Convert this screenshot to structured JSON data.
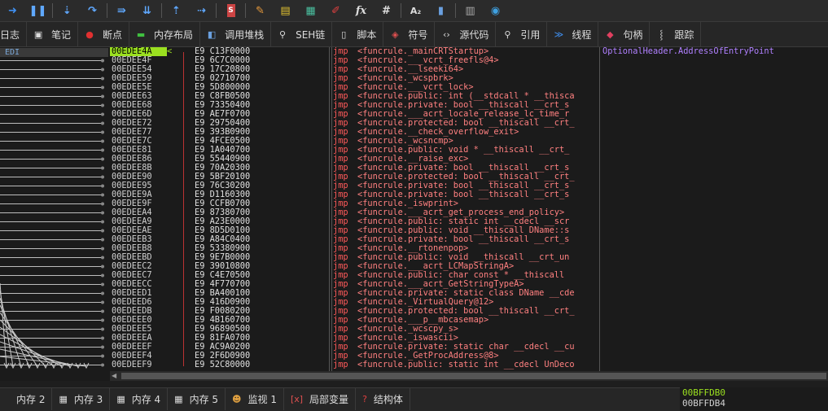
{
  "toolbar": {
    "icons": [
      "arrow-right-icon",
      "pause-icon",
      "step-into-icon",
      "step-over-icon",
      "run-to-icon",
      "step-down-icon",
      "step-up-icon",
      "execute-till-icon",
      "script-icon",
      "pen-icon",
      "highlight-icon",
      "pattern-icon",
      "erase-icon",
      "fx",
      "#",
      "A2",
      "find-icon",
      "calc-icon",
      "globe-icon"
    ],
    "text": {
      "fx": "fx",
      "hash": "#",
      "a2": "A₂"
    }
  },
  "tabs": [
    {
      "label": "日志",
      "icon": "log-icon"
    },
    {
      "label": "笔记",
      "icon": "notes-icon"
    },
    {
      "label": "断点",
      "icon": "breakpoint-icon"
    },
    {
      "label": "内存布局",
      "icon": "memory-map-icon"
    },
    {
      "label": "调用堆栈",
      "icon": "call-stack-icon"
    },
    {
      "label": "SEH链",
      "icon": "seh-icon"
    },
    {
      "label": "脚本",
      "icon": "script-icon"
    },
    {
      "label": "符号",
      "icon": "symbols-icon"
    },
    {
      "label": "源代码",
      "icon": "source-icon"
    },
    {
      "label": "引用",
      "icon": "references-icon"
    },
    {
      "label": "线程",
      "icon": "threads-icon"
    },
    {
      "label": "句柄",
      "icon": "handles-icon"
    },
    {
      "label": "跟踪",
      "icon": "trace-icon"
    }
  ],
  "graph": {
    "register_label": "EDI"
  },
  "disasm": {
    "rows": [
      {
        "addr": "00EDEE4A",
        "arrow": "<",
        "bytes": "E9 C13F0000",
        "mn": "jmp",
        "op": "<funcrule._mainCRTStartup>",
        "sel": true
      },
      {
        "addr": "00EDEE4F",
        "arrow": "",
        "bytes": "E9 6C7C0000",
        "mn": "jmp",
        "op": "<funcrule.___vcrt_freefls@4>"
      },
      {
        "addr": "00EDEE54",
        "arrow": "",
        "bytes": "E9 17C20800",
        "mn": "jmp",
        "op": "<funcrule.__lseeki64>"
      },
      {
        "addr": "00EDEE59",
        "arrow": "",
        "bytes": "E9 02710700",
        "mn": "jmp",
        "op": "<funcrule._wcspbrk>"
      },
      {
        "addr": "00EDEE5E",
        "arrow": "",
        "bytes": "E9 5D800000",
        "mn": "jmp",
        "op": "<funcrule.___vcrt_lock>"
      },
      {
        "addr": "00EDEE63",
        "arrow": "",
        "bytes": "E9 C8FB0500",
        "mn": "jmp",
        "op": "<funcrule.public: int (__stdcall * __thisca"
      },
      {
        "addr": "00EDEE68",
        "arrow": "",
        "bytes": "E9 73350400",
        "mn": "jmp",
        "op": "<funcrule.private: bool __thiscall __crt_s"
      },
      {
        "addr": "00EDEE6D",
        "arrow": "",
        "bytes": "E9 AE7F0700",
        "mn": "jmp",
        "op": "<funcrule.___acrt_locale_release_lc_time_r"
      },
      {
        "addr": "00EDEE72",
        "arrow": "",
        "bytes": "E9 29750400",
        "mn": "jmp",
        "op": "<funcrule.protected: bool __thiscall __crt_"
      },
      {
        "addr": "00EDEE77",
        "arrow": "",
        "bytes": "E9 393B0900",
        "mn": "jmp",
        "op": "<funcrule.__check_overflow_exit>"
      },
      {
        "addr": "00EDEE7C",
        "arrow": "",
        "bytes": "E9 4FCE0500",
        "mn": "jmp",
        "op": "<funcrule._wcsncmp>"
      },
      {
        "addr": "00EDEE81",
        "arrow": "",
        "bytes": "E9 1A040700",
        "mn": "jmp",
        "op": "<funcrule.public: void * __thiscall __crt_"
      },
      {
        "addr": "00EDEE86",
        "arrow": "",
        "bytes": "E9 55440900",
        "mn": "jmp",
        "op": "<funcrule.__raise_exc>"
      },
      {
        "addr": "00EDEE8B",
        "arrow": "",
        "bytes": "E9 70A20300",
        "mn": "jmp",
        "op": "<funcrule.private: bool __thiscall __crt_s"
      },
      {
        "addr": "00EDEE90",
        "arrow": "",
        "bytes": "E9 5BF20100",
        "mn": "jmp",
        "op": "<funcrule.protected: bool __thiscall __crt_"
      },
      {
        "addr": "00EDEE95",
        "arrow": "",
        "bytes": "E9 76C30200",
        "mn": "jmp",
        "op": "<funcrule.private: bool __thiscall __crt_s"
      },
      {
        "addr": "00EDEE9A",
        "arrow": "",
        "bytes": "E9 D1160300",
        "mn": "jmp",
        "op": "<funcrule.private: bool __thiscall __crt_s"
      },
      {
        "addr": "00EDEE9F",
        "arrow": "",
        "bytes": "E9 CCFB0700",
        "mn": "jmp",
        "op": "<funcrule._iswprint>"
      },
      {
        "addr": "00EDEEA4",
        "arrow": "",
        "bytes": "E9 87380700",
        "mn": "jmp",
        "op": "<funcrule.___acrt_get_process_end_policy>"
      },
      {
        "addr": "00EDEEA9",
        "arrow": "",
        "bytes": "E9 A23E0000",
        "mn": "jmp",
        "op": "<funcrule.public: static int __cdecl __scr"
      },
      {
        "addr": "00EDEEAE",
        "arrow": "",
        "bytes": "E9 8D5D0100",
        "mn": "jmp",
        "op": "<funcrule.public: void __thiscall DName::s"
      },
      {
        "addr": "00EDEEB3",
        "arrow": "",
        "bytes": "E9 A84C0400",
        "mn": "jmp",
        "op": "<funcrule.private: bool __thiscall __crt_s"
      },
      {
        "addr": "00EDEEB8",
        "arrow": "",
        "bytes": "E9 53380900",
        "mn": "jmp",
        "op": "<funcrule.__rtonenpop>"
      },
      {
        "addr": "00EDEEBD",
        "arrow": "",
        "bytes": "E9 9E7B0000",
        "mn": "jmp",
        "op": "<funcrule.public: void __thiscall __crt_un"
      },
      {
        "addr": "00EDEEC2",
        "arrow": "",
        "bytes": "E9 39010800",
        "mn": "jmp",
        "op": "<funcrule.___acrt_LCMapStringA>"
      },
      {
        "addr": "00EDEEC7",
        "arrow": "",
        "bytes": "E9 C4E70500",
        "mn": "jmp",
        "op": "<funcrule.public: char const * __thiscall "
      },
      {
        "addr": "00EDEECC",
        "arrow": "",
        "bytes": "E9 4F770700",
        "mn": "jmp",
        "op": "<funcrule.___acrt_GetStringTypeA>"
      },
      {
        "addr": "00EDEED1",
        "arrow": "",
        "bytes": "E9 BA400100",
        "mn": "jmp",
        "op": "<funcrule.private: static class DName __cde"
      },
      {
        "addr": "00EDEED6",
        "arrow": "",
        "bytes": "E9 416D0900",
        "mn": "jmp",
        "op": "<funcrule._VirtualQuery@12>"
      },
      {
        "addr": "00EDEEDB",
        "arrow": "",
        "bytes": "E9 F0080200",
        "mn": "jmp",
        "op": "<funcrule.protected: bool __thiscall __crt_"
      },
      {
        "addr": "00EDEEE0",
        "arrow": "",
        "bytes": "E9 4B160700",
        "mn": "jmp",
        "op": "<funcrule.___p__mbcasemap>"
      },
      {
        "addr": "00EDEEE5",
        "arrow": "",
        "bytes": "E9 96890500",
        "mn": "jmp",
        "op": "<funcrule._wcscpy_s>"
      },
      {
        "addr": "00EDEEEA",
        "arrow": "",
        "bytes": "E9 81FA0700",
        "mn": "jmp",
        "op": "<funcrule._iswascii>"
      },
      {
        "addr": "00EDEEEF",
        "arrow": "",
        "bytes": "E9 AC9A0200",
        "mn": "jmp",
        "op": "<funcrule.private: static char __cdecl __cu"
      },
      {
        "addr": "00EDEEF4",
        "arrow": "",
        "bytes": "E9 2F6D0900",
        "mn": "jmp",
        "op": "<funcrule._GetProcAddress@8>"
      },
      {
        "addr": "00EDEEF9",
        "arrow": "",
        "bytes": "E9 52C80000",
        "mn": "jmp",
        "op": "<funcrule.public: static int __cdecl UnDeco"
      }
    ],
    "comment": "OptionalHeader.AddressOfEntryPoint"
  },
  "bottom_tabs": [
    {
      "label": "内存 2",
      "icon": "memory-icon"
    },
    {
      "label": "内存 3",
      "icon": "memory-icon"
    },
    {
      "label": "内存 4",
      "icon": "memory-icon"
    },
    {
      "label": "内存 5",
      "icon": "memory-icon"
    },
    {
      "label": "监视 1",
      "icon": "watch-icon"
    },
    {
      "label": "局部变量",
      "icon": "locals-icon"
    },
    {
      "label": "结构体",
      "icon": "struct-icon"
    }
  ],
  "stack": {
    "line1": "00BFFDB0",
    "line2": "00BFFDB4"
  },
  "colors": {
    "selected": "#9be020",
    "mnemonic": "#ff5a5a",
    "comment": "#b080ff"
  }
}
